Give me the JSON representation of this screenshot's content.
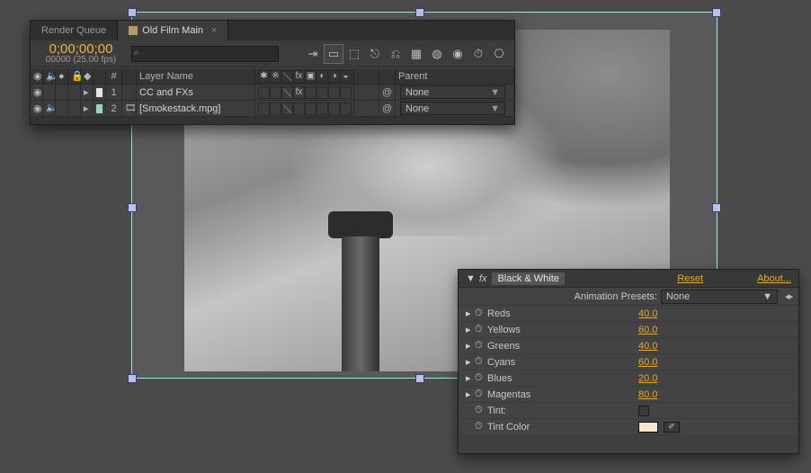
{
  "tabs": {
    "render_queue": "Render Queue",
    "comp_name": "Old Film Main",
    "close_glyph": "×"
  },
  "time": {
    "code": "0;00;00;00",
    "sub": "00000 (25.00 fps)"
  },
  "search": {
    "placeholder": "",
    "mag": "⌕"
  },
  "toolbar_glyphs": [
    "⇥",
    "▭",
    "⬚",
    "⎋",
    "⎌",
    "▦",
    "◍",
    "◉",
    "⏱",
    "⎔"
  ],
  "columns": {
    "hash": "#",
    "layer_name": "Layer Name",
    "parent": "Parent"
  },
  "switch_header_glyphs": [
    "✱",
    "※",
    "＼",
    "fx",
    "▣",
    "◐",
    "◑",
    "◒"
  ],
  "layers": [
    {
      "index": "1",
      "color": "#e6e6e6",
      "name": "CC and FXs",
      "parent": "None",
      "eye": "◉",
      "speaker": "",
      "twirl": "▸",
      "src_glyph": "",
      "switches": [
        "",
        "",
        "＼",
        "fx",
        "",
        "",
        "",
        ""
      ]
    },
    {
      "index": "2",
      "color": "#8fd6c8",
      "name": "[Smokestack.mpg]",
      "parent": "None",
      "eye": "◉",
      "speaker": "🔈",
      "twirl": "▸",
      "src_glyph": "🎞",
      "switches": [
        "",
        "",
        "＼",
        "",
        "",
        "",
        "",
        ""
      ]
    }
  ],
  "effect": {
    "twirl": "▼",
    "fx_glyph": "fx",
    "name": "Black & White",
    "reset": "Reset",
    "about": "About...",
    "presets_label": "Animation Presets:",
    "preset_value": "None",
    "nav": "◂▸",
    "props": [
      {
        "tw": "▸",
        "stop": "⏱",
        "name": "Reds",
        "value": "40.0"
      },
      {
        "tw": "▸",
        "stop": "⏱",
        "name": "Yellows",
        "value": "60.0"
      },
      {
        "tw": "▸",
        "stop": "⏱",
        "name": "Greens",
        "value": "40.0"
      },
      {
        "tw": "▸",
        "stop": "⏱",
        "name": "Cyans",
        "value": "60.0"
      },
      {
        "tw": "▸",
        "stop": "⏱",
        "name": "Blues",
        "value": "20.0"
      },
      {
        "tw": "▸",
        "stop": "⏱",
        "name": "Magentas",
        "value": "80.0"
      }
    ],
    "tint_label": "Tint:",
    "tint_color_label": "Tint Color",
    "tint_swatch": "#f3e7cf",
    "eyedrop_glyph": "✐"
  },
  "glyphs": {
    "dropdown": "▼",
    "spiral": "@",
    "chevron": "▸",
    "crosshair": "✛"
  }
}
